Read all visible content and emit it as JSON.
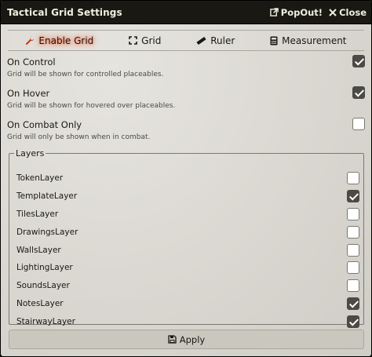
{
  "window": {
    "title": "Tactical Grid Settings",
    "popout_label": "PopOut!",
    "close_label": "Close"
  },
  "tabs": [
    {
      "label": "Enable Grid",
      "icon": "wrench-icon",
      "active": true
    },
    {
      "label": "Grid",
      "icon": "expand-icon",
      "active": false
    },
    {
      "label": "Ruler",
      "icon": "ruler-icon",
      "active": false
    },
    {
      "label": "Measurement",
      "icon": "calculator-icon",
      "active": false
    }
  ],
  "settings": [
    {
      "label": "On Control",
      "hint": "Grid will be shown for controlled placeables.",
      "checked": true
    },
    {
      "label": "On Hover",
      "hint": "Grid will be shown for hovered over placeables.",
      "checked": true
    },
    {
      "label": "On Combat Only",
      "hint": "Grid will only be shown when in combat.",
      "checked": false
    }
  ],
  "layers": {
    "legend": "Layers",
    "items": [
      {
        "label": "TokenLayer",
        "checked": false
      },
      {
        "label": "TemplateLayer",
        "checked": true
      },
      {
        "label": "TilesLayer",
        "checked": false
      },
      {
        "label": "DrawingsLayer",
        "checked": false
      },
      {
        "label": "WallsLayer",
        "checked": false
      },
      {
        "label": "LightingLayer",
        "checked": false
      },
      {
        "label": "SoundsLayer",
        "checked": false
      },
      {
        "label": "NotesLayer",
        "checked": true
      },
      {
        "label": "StairwayLayer",
        "checked": true
      }
    ]
  },
  "apply_label": "Apply",
  "colors": {
    "titlebar": "#191813",
    "background": "#dcdad4",
    "checkbox_checked": "#4b4a44",
    "active_tab_glow": "#ff3b16"
  }
}
